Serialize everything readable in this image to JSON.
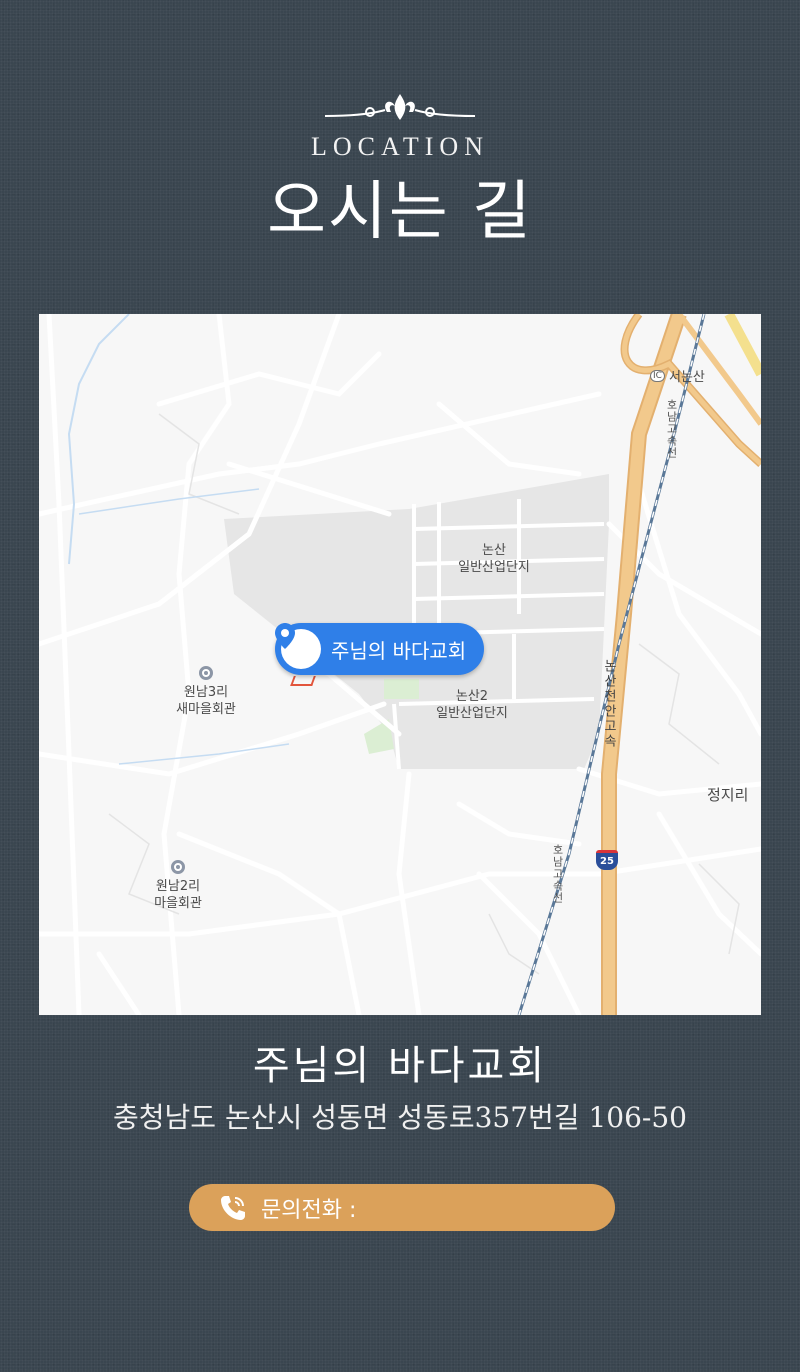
{
  "header": {
    "eyebrow": "LOCATION",
    "title": "오시는 길",
    "ornament_icon": "flourish-ornament-icon"
  },
  "map": {
    "marker_label": "주님의 바다교회",
    "marker_icon": "location-pin-icon",
    "labels": {
      "industrial_1_line1": "논산",
      "industrial_1_line2": "일반산업단지",
      "industrial_2_line1": "논산2",
      "industrial_2_line2": "일반산업단지",
      "wonnam3_line1": "원남3리",
      "wonnam3_line2": "새마을회관",
      "wonnam2_line1": "원남2리",
      "wonnam2_line2": "마을회관",
      "jeongji": "정지리",
      "ic_badge": "IC",
      "ic_name": "서논산",
      "rail_north": "호남고속선",
      "rail_south": "호남고속선",
      "highway": "논산천안고속",
      "route_number": "25"
    },
    "colors": {
      "background": "#f7f7f7",
      "highway": "#f2c98c",
      "industrial_area": "#e6e6e6",
      "marker": "#2f7fe8",
      "rail": "#5a7898"
    }
  },
  "info": {
    "place_name": "주님의 바다교회",
    "address": "충청남도 논산시 성동면 성동로357번길 106-50"
  },
  "call": {
    "label": "문의전화 :",
    "icon": "phone-icon",
    "color": "#dba15a"
  }
}
